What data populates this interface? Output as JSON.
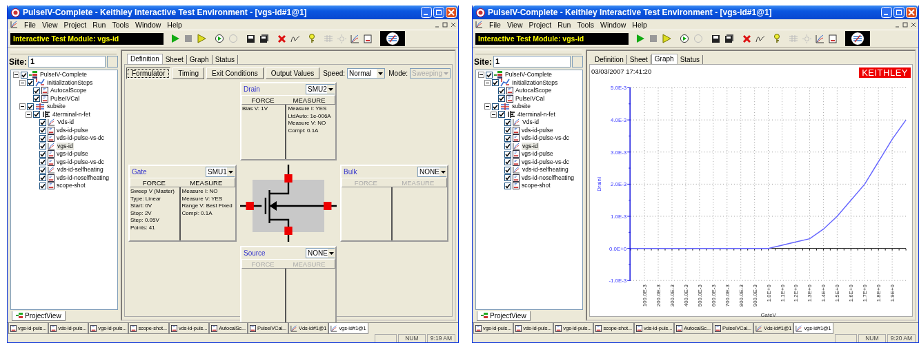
{
  "windows": [
    {
      "title": "PulseIV-Complete - Keithley Interactive Test Environment - [vgs-id#1@1]",
      "menu": [
        "File",
        "View",
        "Project",
        "Run",
        "Tools",
        "Window",
        "Help"
      ],
      "module_label": "Interactive Test Module: vgs-id",
      "site": {
        "label": "Site:",
        "value": "1"
      },
      "tree": [
        {
          "label": "PulseIV-Complete",
          "kind": "project",
          "checked": true,
          "selected": false,
          "expanded": true,
          "children": [
            {
              "label": "InitializationSteps",
              "kind": "sequence",
              "checked": true,
              "selected": false,
              "expanded": true,
              "children": [
                {
                  "label": "AutocalScope",
                  "kind": "doc",
                  "checked": true,
                  "selected": false
                },
                {
                  "label": "PulseIVCal",
                  "kind": "doc",
                  "checked": true,
                  "selected": false
                }
              ]
            },
            {
              "label": "subsite",
              "kind": "subsite",
              "checked": true,
              "selected": false,
              "expanded": true,
              "children": [
                {
                  "label": "4terminal-n-fet",
                  "kind": "device",
                  "checked": true,
                  "selected": false,
                  "expanded": true,
                  "children": [
                    {
                      "label": "Vds-id",
                      "kind": "itm",
                      "checked": true,
                      "selected": false
                    },
                    {
                      "label": "vds-id-pulse",
                      "kind": "doc",
                      "checked": true,
                      "selected": false
                    },
                    {
                      "label": "vds-id-pulse-vs-dc",
                      "kind": "doc",
                      "checked": true,
                      "selected": false
                    },
                    {
                      "label": "vgs-id",
                      "kind": "itm",
                      "checked": true,
                      "selected": true
                    },
                    {
                      "label": "vgs-id-pulse",
                      "kind": "doc",
                      "checked": true,
                      "selected": false
                    },
                    {
                      "label": "vgs-id-pulse-vs-dc",
                      "kind": "doc",
                      "checked": true,
                      "selected": false
                    },
                    {
                      "label": "vds-id-selfheating",
                      "kind": "itm",
                      "checked": true,
                      "selected": false
                    },
                    {
                      "label": "vds-id-noselfheating",
                      "kind": "doc",
                      "checked": true,
                      "selected": false
                    },
                    {
                      "label": "scope-shot",
                      "kind": "doc",
                      "checked": true,
                      "selected": false
                    }
                  ]
                }
              ]
            }
          ]
        }
      ],
      "panel_tab": "ProjectView",
      "tabs": [
        {
          "label": "Definition",
          "selected": true
        },
        {
          "label": "Sheet",
          "selected": false
        },
        {
          "label": "Graph",
          "selected": false
        },
        {
          "label": "Status",
          "selected": false
        }
      ],
      "view": {
        "kind": "definition",
        "buttons": [
          {
            "label": "Formulator",
            "selected": true
          },
          {
            "label": "Timing",
            "selected": false
          },
          {
            "label": "Exit Conditions",
            "selected": false
          },
          {
            "label": "Output Values",
            "selected": false
          }
        ],
        "speed": {
          "label": "Speed:",
          "value": "Normal"
        },
        "mode": {
          "label": "Mode:",
          "value": "Sweeping",
          "disabled": true
        },
        "terminals": [
          {
            "name": "Drain",
            "instrument": "SMU2",
            "enabled": true,
            "force_header": "FORCE",
            "measure_header": "MEASURE",
            "force": [
              "Bias V: 1V"
            ],
            "measure": [
              "Measure I: YES",
              "LtdAuto: 1e-006A",
              "Measure V: NO",
              "Compl: 0.1A"
            ]
          },
          {
            "name": "Gate",
            "instrument": "SMU1",
            "enabled": true,
            "force_header": "FORCE",
            "measure_header": "MEASURE",
            "force": [
              "Sweep V (Master)",
              "Type: Linear",
              "Start: 0V",
              "Stop: 2V",
              "Step: 0.05V",
              "Points: 41"
            ],
            "measure": [
              "Measure I: NO",
              "Measure V: YES",
              "Range V: Best Fixed",
              "Compl: 0.1A"
            ]
          },
          {
            "name": "Bulk",
            "instrument": "NONE",
            "enabled": false,
            "force_header": "FORCE",
            "measure_header": "MEASURE"
          },
          {
            "name": "Source",
            "instrument": "NONE",
            "enabled": false,
            "force_header": "FORCE",
            "measure_header": "MEASURE"
          }
        ]
      },
      "documents": [
        {
          "label": "vgs-id-puls...",
          "kind": "doc",
          "selected": false
        },
        {
          "label": "vds-id-puls...",
          "kind": "doc",
          "selected": false
        },
        {
          "label": "vgs-id-puls...",
          "kind": "doc",
          "selected": false
        },
        {
          "label": "scope-shot...",
          "kind": "doc",
          "selected": false
        },
        {
          "label": "vds-id-puls...",
          "kind": "doc",
          "selected": false
        },
        {
          "label": "AutocalSc...",
          "kind": "doc",
          "selected": false
        },
        {
          "label": "PulseIVCal...",
          "kind": "doc",
          "selected": false
        },
        {
          "label": "Vds-id#1@1",
          "kind": "itm",
          "selected": false
        },
        {
          "label": "vgs-id#1@1",
          "kind": "itm",
          "selected": true
        }
      ],
      "status": [
        "NUM",
        "9:19 AM"
      ]
    },
    {
      "title": "PulseIV-Complete - Keithley Interactive Test Environment - [vgs-id#1@1]",
      "menu": [
        "File",
        "View",
        "Project",
        "Run",
        "Tools",
        "Window",
        "Help"
      ],
      "module_label": "Interactive Test Module: vgs-id",
      "site": {
        "label": "Site:",
        "value": "1"
      },
      "tree": [
        {
          "label": "PulseIV-Complete",
          "kind": "project",
          "checked": true,
          "selected": false,
          "expanded": true,
          "children": [
            {
              "label": "InitializationSteps",
              "kind": "sequence",
              "checked": true,
              "selected": false,
              "expanded": true,
              "children": [
                {
                  "label": "AutocalScope",
                  "kind": "doc",
                  "checked": true,
                  "selected": false
                },
                {
                  "label": "PulseIVCal",
                  "kind": "doc",
                  "checked": true,
                  "selected": false
                }
              ]
            },
            {
              "label": "subsite",
              "kind": "subsite",
              "checked": true,
              "selected": false,
              "expanded": true,
              "children": [
                {
                  "label": "4terminal-n-fet",
                  "kind": "device",
                  "checked": true,
                  "selected": false,
                  "expanded": true,
                  "children": [
                    {
                      "label": "Vds-id",
                      "kind": "itm",
                      "checked": true,
                      "selected": false
                    },
                    {
                      "label": "vds-id-pulse",
                      "kind": "doc",
                      "checked": true,
                      "selected": false
                    },
                    {
                      "label": "vds-id-pulse-vs-dc",
                      "kind": "doc",
                      "checked": true,
                      "selected": false
                    },
                    {
                      "label": "vgs-id",
                      "kind": "itm",
                      "checked": true,
                      "selected": true
                    },
                    {
                      "label": "vgs-id-pulse",
                      "kind": "doc",
                      "checked": true,
                      "selected": false
                    },
                    {
                      "label": "vgs-id-pulse-vs-dc",
                      "kind": "doc",
                      "checked": true,
                      "selected": false
                    },
                    {
                      "label": "vds-id-selfheating",
                      "kind": "itm",
                      "checked": true,
                      "selected": false
                    },
                    {
                      "label": "vds-id-noselfheating",
                      "kind": "doc",
                      "checked": true,
                      "selected": false
                    },
                    {
                      "label": "scope-shot",
                      "kind": "doc",
                      "checked": true,
                      "selected": false
                    }
                  ]
                }
              ]
            }
          ]
        }
      ],
      "panel_tab": "ProjectView",
      "tabs": [
        {
          "label": "Definition",
          "selected": false
        },
        {
          "label": "Sheet",
          "selected": false
        },
        {
          "label": "Graph",
          "selected": true
        },
        {
          "label": "Status",
          "selected": false
        }
      ],
      "view": {
        "kind": "graph",
        "timestamp": "03/03/2007 17:41:20",
        "logo": "KEITHLEY",
        "chart_data": {
          "type": "line",
          "xlabel": "GateV",
          "ylabel": "DrainI",
          "grid": true,
          "x": [
            0,
            0.1,
            0.2,
            0.3,
            0.4,
            0.5,
            0.6,
            0.7,
            0.8,
            0.9,
            1.0,
            1.1,
            1.2,
            1.3,
            1.4,
            1.5,
            1.6,
            1.7,
            1.8,
            1.9,
            2.0
          ],
          "series": [
            {
              "color": "#6666ff",
              "values": [
                0,
                0,
                0,
                0,
                0,
                0,
                0,
                0,
                0,
                0,
                0,
                0.0001,
                0.0002,
                0.0003,
                0.0006,
                0.001,
                0.0015,
                0.002,
                0.0027,
                0.0034,
                0.004
              ]
            }
          ],
          "xlim": [
            0,
            2
          ],
          "ylim": [
            -0.001,
            0.005
          ],
          "xticks": [
            {
              "value": 0.1,
              "label": "100.0E-3"
            },
            {
              "value": 0.2,
              "label": "200.0E-3"
            },
            {
              "value": 0.3,
              "label": "300.0E-3"
            },
            {
              "value": 0.4,
              "label": "400.0E-3"
            },
            {
              "value": 0.5,
              "label": "500.0E-3"
            },
            {
              "value": 0.6,
              "label": "600.0E-3"
            },
            {
              "value": 0.7,
              "label": "700.0E-3"
            },
            {
              "value": 0.8,
              "label": "800.0E-3"
            },
            {
              "value": 0.9,
              "label": "900.0E-3"
            },
            {
              "value": 1.0,
              "label": "1.0E+0"
            },
            {
              "value": 1.1,
              "label": "1.1E+0"
            },
            {
              "value": 1.2,
              "label": "1.2E+0"
            },
            {
              "value": 1.3,
              "label": "1.3E+0"
            },
            {
              "value": 1.4,
              "label": "1.4E+0"
            },
            {
              "value": 1.5,
              "label": "1.5E+0"
            },
            {
              "value": 1.6,
              "label": "1.6E+0"
            },
            {
              "value": 1.7,
              "label": "1.7E+0"
            },
            {
              "value": 1.8,
              "label": "1.8E+0"
            },
            {
              "value": 1.9,
              "label": "1.9E+0"
            }
          ],
          "yticks": [
            {
              "value": -0.001,
              "label": "-1.0E-3"
            },
            {
              "value": 0,
              "label": "0.0E+0"
            },
            {
              "value": 0.001,
              "label": "1.0E-3"
            },
            {
              "value": 0.002,
              "label": "2.0E-3"
            },
            {
              "value": 0.003,
              "label": "3.0E-3"
            },
            {
              "value": 0.004,
              "label": "4.0E-3"
            },
            {
              "value": 0.005,
              "label": "5.0E-3"
            }
          ]
        }
      },
      "documents": [
        {
          "label": "vgs-id-puls...",
          "kind": "doc",
          "selected": false
        },
        {
          "label": "vds-id-puls...",
          "kind": "doc",
          "selected": false
        },
        {
          "label": "vgs-id-puls...",
          "kind": "doc",
          "selected": false
        },
        {
          "label": "scope-shot...",
          "kind": "doc",
          "selected": false
        },
        {
          "label": "vds-id-puls...",
          "kind": "doc",
          "selected": false
        },
        {
          "label": "AutocalSc...",
          "kind": "doc",
          "selected": false
        },
        {
          "label": "PulseIVCal...",
          "kind": "doc",
          "selected": false
        },
        {
          "label": "Vds-id#1@1",
          "kind": "itm",
          "selected": false
        },
        {
          "label": "vgs-id#1@1",
          "kind": "itm",
          "selected": true
        }
      ],
      "status": [
        "NUM",
        "9:20 AM"
      ]
    }
  ]
}
